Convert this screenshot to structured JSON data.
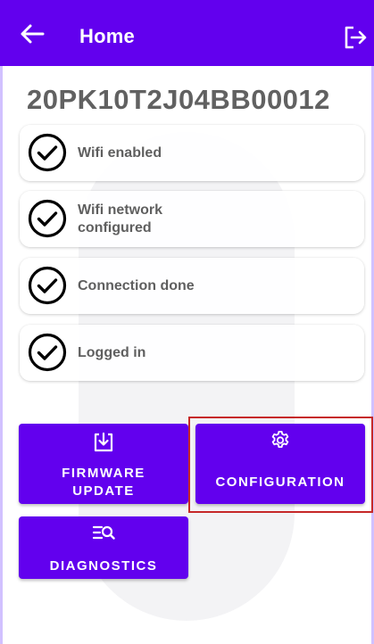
{
  "appbar": {
    "title": "Home",
    "back_icon": "arrow-left-icon",
    "logout_icon": "logout-icon",
    "color": "#6200ee"
  },
  "device": {
    "serial": "20PK10T2J04BB00012"
  },
  "status_items": [
    {
      "label": "Wifi enabled",
      "icon": "check-circle-icon",
      "done": true
    },
    {
      "label_line1": "Wifi network",
      "label_line2": "configured",
      "icon": "check-circle-icon",
      "done": true
    },
    {
      "label": "Connection done",
      "icon": "check-circle-icon",
      "done": true
    },
    {
      "label": "Logged in",
      "icon": "check-circle-icon",
      "done": true
    }
  ],
  "actions": {
    "firmware": {
      "line1": "FIRMWARE",
      "line2": "UPDATE",
      "icon": "download-icon"
    },
    "configuration": {
      "label": "CONFIGURATION",
      "icon": "gear-icon",
      "highlighted": true
    },
    "diagnostics": {
      "label": "DIAGNOSTICS",
      "icon": "search-list-icon"
    }
  },
  "colors": {
    "accent": "#6200ee",
    "highlight_border": "#c62828",
    "status_text": "#5f5f5f",
    "serial_text": "#616161"
  }
}
